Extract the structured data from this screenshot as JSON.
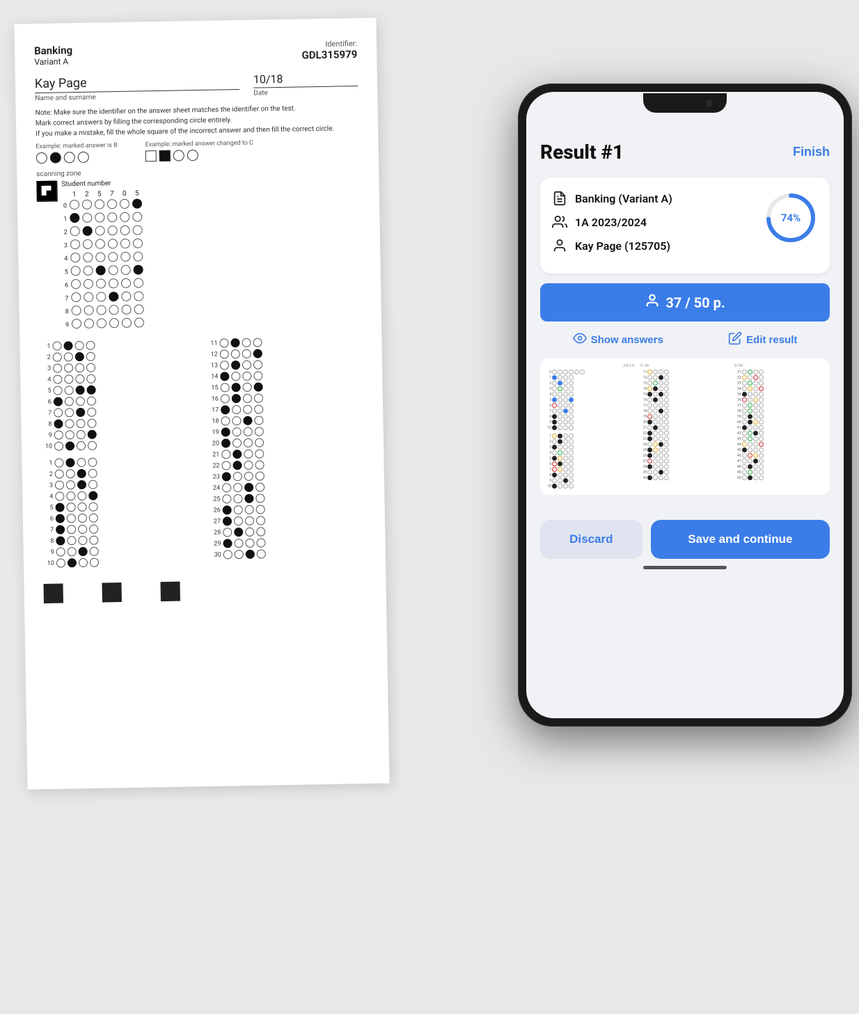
{
  "sheet": {
    "title": "Banking",
    "variant": "Variant A",
    "identifier_label": "Identifier:",
    "identifier_value": "GDL315979",
    "name_value": "Kay Page",
    "name_label": "Name and surname",
    "date_value": "10/18",
    "date_label": "Date",
    "note1": "Note: Make sure the identifier on the answer sheet matches the identifier on the test.",
    "note2": "Mark correct answers by filling the corresponding circle entirely.",
    "note3": "If you make a mistake, fill the whole square of the incorrect answer and then fill the correct circle.",
    "example1_label": "Example: marked answer is B",
    "example2_label": "Example: marked answer changed to C",
    "scanning_zone": "scanning zone",
    "student_number_label": "Student number",
    "student_number_digits": [
      "1",
      "2",
      "5",
      "7",
      "0",
      "5"
    ]
  },
  "phone": {
    "result_title": "Result #1",
    "finish_label": "Finish",
    "course_name": "Banking (Variant A)",
    "class_name": "1A 2023/2024",
    "student_name": "Kay Page (125705)",
    "progress_percent": "74%",
    "score": "37 / 50 p.",
    "show_answers_label": "Show answers",
    "edit_result_label": "Edit result",
    "discard_label": "Discard",
    "save_label": "Save and continue"
  }
}
